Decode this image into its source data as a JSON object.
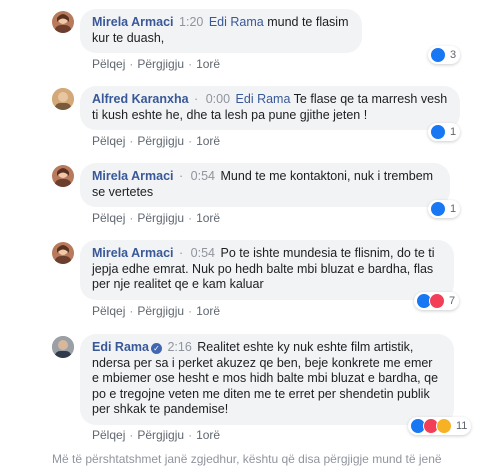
{
  "actions": {
    "like": "Pëlqej",
    "reply": "Përgjigju"
  },
  "comments": [
    {
      "author": "Mirela Armaci",
      "timestamp": "1:20",
      "mention": "Edi Rama",
      "text": "mund te flasim kur te duash,",
      "time": "1orë",
      "reaction_count": "3",
      "reactions": [
        "like"
      ],
      "avatar_color": "#b87a5c"
    },
    {
      "author": "Alfred Karanxha",
      "timestamp": "0:00",
      "mention": "Edi Rama",
      "text": "Te flase qe ta marresh vesh ti kush eshte he, dhe ta lesh pa pune gjithe jeten !",
      "time": "1orë",
      "reaction_count": "1",
      "reactions": [
        "like"
      ],
      "avatar_color": "#c9a070"
    },
    {
      "author": "Mirela Armaci",
      "timestamp": "0:54",
      "mention": "",
      "text": "Mund te me kontaktoni, nuk i trembem se vertetes",
      "time": "1orë",
      "reaction_count": "1",
      "reactions": [
        "like"
      ],
      "avatar_color": "#b87a5c"
    },
    {
      "author": "Mirela Armaci",
      "timestamp": "0:54",
      "mention": "",
      "text": "Po te ishte mundesia te flisnim, do te ti jepja edhe emrat. Nuk po hedh balte mbi bluzat e bardha, flas per nje realitet qe e kam kaluar",
      "time": "1orë",
      "reaction_count": "7",
      "reactions": [
        "like",
        "love"
      ],
      "avatar_color": "#b87a5c"
    },
    {
      "author": "Edi Rama",
      "timestamp": "2:16",
      "mention": "",
      "text": "Realitet eshte ky nuk eshte film artistik, ndersa per sa i perket akuzez qe ben, beje konkrete me emer e mbiemer ose hesht e mos hidh balte mbi bluzat e bardha, qe po e tregojne veten me diten me te erret per shendetin publik per shkak te pandemise!",
      "time": "1orë",
      "reaction_count": "11",
      "reactions": [
        "like",
        "love",
        "haha"
      ],
      "avatar_color": "#8a8f96",
      "verified": true
    }
  ],
  "footer": "Më të përshtatshmet janë zgjedhur, kështu që disa përgjigje mund të jenë"
}
